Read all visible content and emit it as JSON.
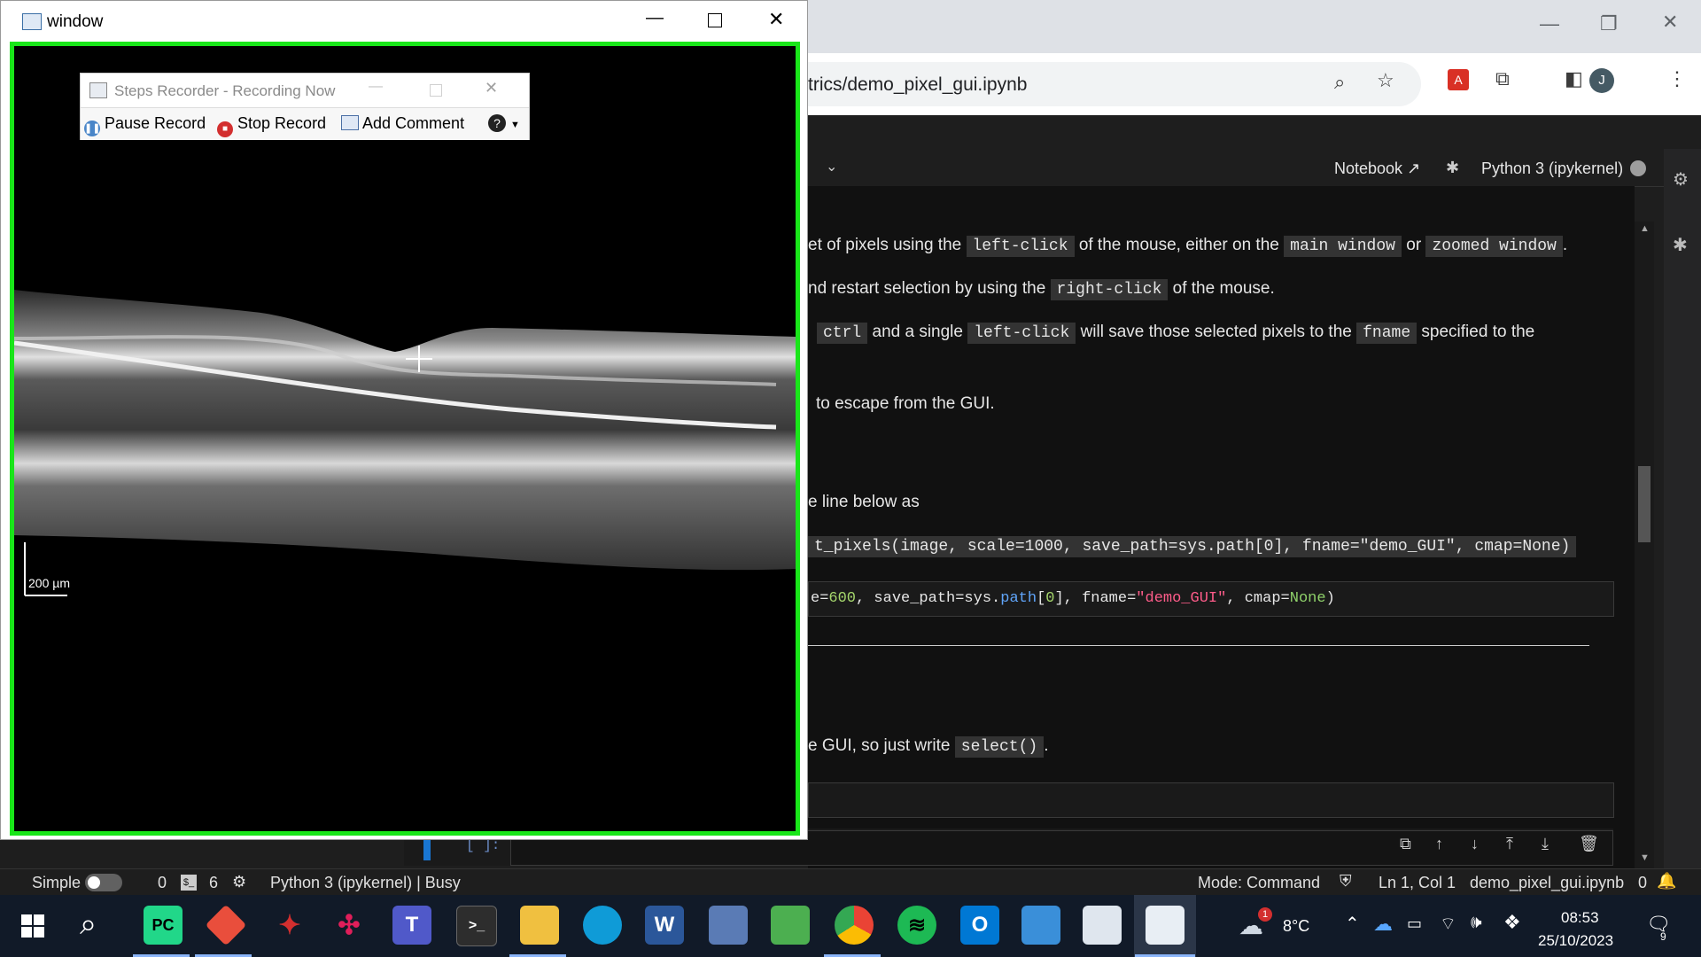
{
  "image_window": {
    "title": "window",
    "scale_label": "200 µm"
  },
  "steps_recorder": {
    "title": "Steps Recorder - Recording Now",
    "pause_label": "Pause Record",
    "stop_label": "Stop Record",
    "comment_label": "Add Comment"
  },
  "browser": {
    "url": "trics/demo_pixel_gui.ipynb",
    "profile_initial": "J"
  },
  "jupyter": {
    "toolbar": {
      "notebook_label": "Notebook",
      "kernel_label": "Python 3 (ipykernel)"
    },
    "md": {
      "l1a": "et of pixels using the",
      "l1_code1": "left-click",
      "l1b": "of the mouse, either on the",
      "l1_code2": "main window",
      "l1c": "or",
      "l1_code3": "zoomed window",
      "l1d": ".",
      "l2a": "nd restart selection by using the",
      "l2_code": "right-click",
      "l2b": "of the mouse.",
      "l3_code1": "ctrl",
      "l3a": "and a single",
      "l3_code2": "left-click",
      "l3b": "will save those selected pixels to the",
      "l3_code3": "fname",
      "l3c": "specified to the",
      "l4": "to escape from the GUI.",
      "l5": "e line below as",
      "l6_code": "t_pixels(image, scale=1000, save_path=sys.path[0], fname=\"demo_GUI\", cmap=None)",
      "l7a": "e GUI, so just write",
      "l7_code": "select()",
      "l7b": "."
    },
    "code_cell": {
      "p1": "e=",
      "n1": "600",
      "p2": ", save_path=sys.",
      "attr": "path",
      "p3": "[",
      "n2": "0",
      "p4": "], fname=",
      "str": "\"demo_GUI\"",
      "p5": ", cmap=",
      "kw": "None",
      "p6": ")"
    },
    "empty_prompt": "[ ]:"
  },
  "statusbar": {
    "mode_label": "Simple",
    "terminals": "0",
    "kernels": "6",
    "kernel_status": "Python 3 (ipykernel) | Busy",
    "mode": "Mode: Command",
    "cursor": "Ln 1, Col 1",
    "file": "demo_pixel_gui.ipynb",
    "notifications": "0"
  },
  "taskbar": {
    "temperature": "8°C",
    "weather_badge": "1",
    "time": "08:53",
    "date": "25/10/2023",
    "notif_count": "9",
    "pycharm_label": "PC",
    "word_label": "W",
    "outlook_label": "O"
  },
  "colors": {
    "frame_green": "#19e619",
    "code_bg": "#333333",
    "number": "#a5d66c",
    "string": "#ff5c8a",
    "attr": "#60a5fa",
    "keyword": "#8fd16a"
  }
}
